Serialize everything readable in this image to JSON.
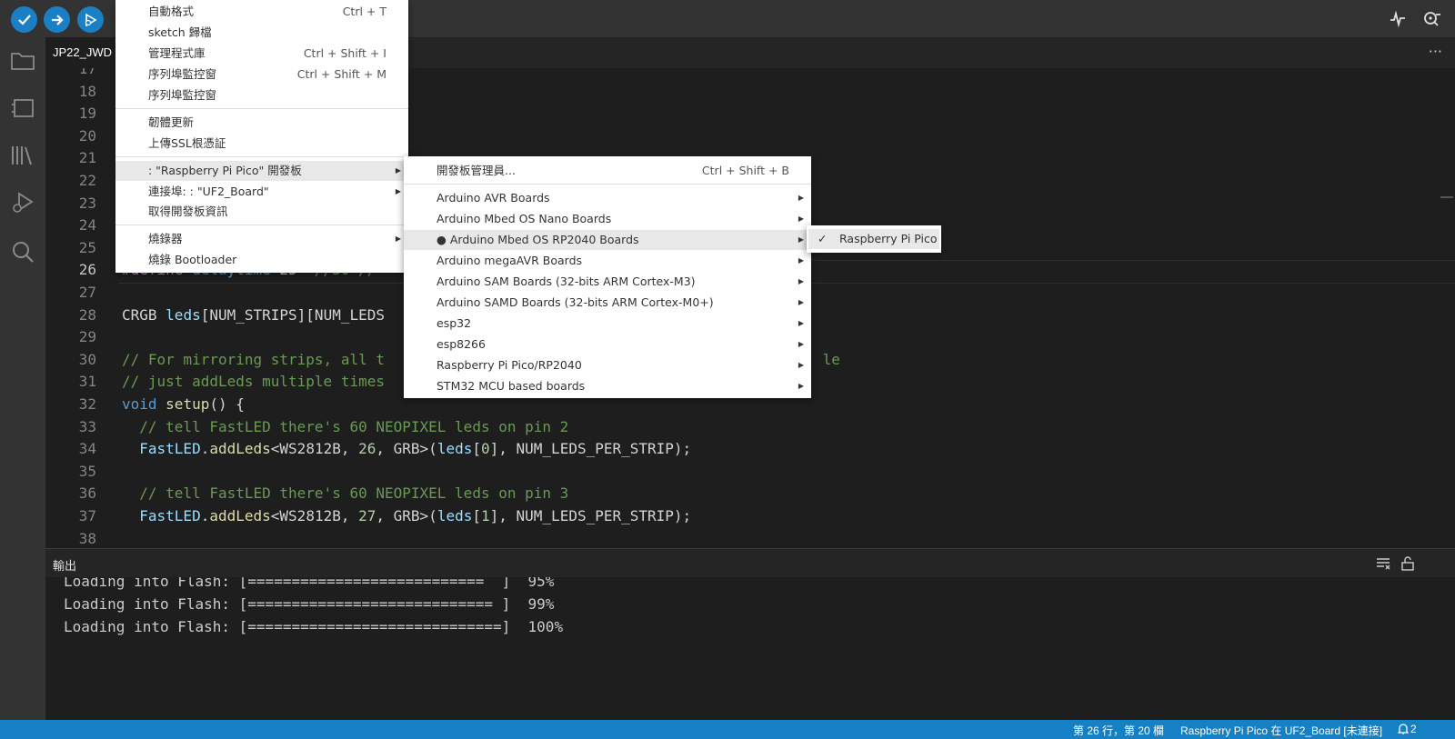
{
  "tab": {
    "label": "JP22_JWD"
  },
  "editor": {
    "lines": [
      {
        "n": "17",
        "parts": []
      },
      {
        "n": "18",
        "parts": []
      },
      {
        "n": "19",
        "parts": []
      },
      {
        "n": "20",
        "parts": []
      },
      {
        "n": "21",
        "parts": []
      },
      {
        "n": "22",
        "parts": []
      },
      {
        "n": "23",
        "parts": []
      },
      {
        "n": "24",
        "parts": []
      },
      {
        "n": "25",
        "parts": []
      },
      {
        "n": "26",
        "parts": [
          {
            "t": "#define ",
            "c": "pre"
          },
          {
            "t": "delaytime ",
            "c": "kw"
          },
          {
            "t": "25",
            "c": "num"
          },
          {
            "t": "  //30 //",
            "c": "com"
          }
        ]
      },
      {
        "n": "27",
        "parts": []
      },
      {
        "n": "28",
        "parts": [
          {
            "t": "CRGB ",
            "c": ""
          },
          {
            "t": "leds",
            "c": "var"
          },
          {
            "t": "[NUM_STRIPS][NUM_LEDS",
            "c": ""
          }
        ]
      },
      {
        "n": "29",
        "parts": []
      },
      {
        "n": "30",
        "parts": [
          {
            "t": "// For mirroring strips, all t",
            "c": "com"
          },
          {
            "t": "                                                  ",
            "c": ""
          },
          {
            "t": "le",
            "c": "com"
          }
        ]
      },
      {
        "n": "31",
        "parts": [
          {
            "t": "// just addLeds multiple times",
            "c": "com"
          }
        ]
      },
      {
        "n": "32",
        "parts": [
          {
            "t": "void ",
            "c": "kw"
          },
          {
            "t": "setup",
            "c": "fn"
          },
          {
            "t": "() {",
            "c": ""
          }
        ]
      },
      {
        "n": "33",
        "parts": [
          {
            "t": "  // tell FastLED there's 60 NEOPIXEL leds on pin 2",
            "c": "com"
          }
        ]
      },
      {
        "n": "34",
        "parts": [
          {
            "t": "  ",
            "c": ""
          },
          {
            "t": "FastLED",
            "c": "var"
          },
          {
            "t": ".",
            "c": ""
          },
          {
            "t": "addLeds",
            "c": "fn"
          },
          {
            "t": "<WS2812B, ",
            "c": ""
          },
          {
            "t": "26",
            "c": "num"
          },
          {
            "t": ", GRB>(",
            "c": ""
          },
          {
            "t": "leds",
            "c": "var"
          },
          {
            "t": "[",
            "c": ""
          },
          {
            "t": "0",
            "c": "num"
          },
          {
            "t": "], NUM_LEDS_PER_STRIP);",
            "c": ""
          }
        ]
      },
      {
        "n": "35",
        "parts": []
      },
      {
        "n": "36",
        "parts": [
          {
            "t": "  // tell FastLED there's 60 NEOPIXEL leds on pin 3",
            "c": "com"
          }
        ]
      },
      {
        "n": "37",
        "parts": [
          {
            "t": "  ",
            "c": ""
          },
          {
            "t": "FastLED",
            "c": "var"
          },
          {
            "t": ".",
            "c": ""
          },
          {
            "t": "addLeds",
            "c": "fn"
          },
          {
            "t": "<WS2812B, ",
            "c": ""
          },
          {
            "t": "27",
            "c": "num"
          },
          {
            "t": ", GRB>(",
            "c": ""
          },
          {
            "t": "leds",
            "c": "var"
          },
          {
            "t": "[",
            "c": ""
          },
          {
            "t": "1",
            "c": "num"
          },
          {
            "t": "], NUM_LEDS_PER_STRIP);",
            "c": ""
          }
        ]
      },
      {
        "n": "38",
        "parts": []
      }
    ]
  },
  "output": {
    "title": "輸出",
    "lines": [
      "Loading into Flash: [===========================  ]  95%",
      "Loading into Flash: [============================ ]  99%",
      "Loading into Flash: [=============================]  100%"
    ]
  },
  "status": {
    "position": "第 26 行，第 20 欄",
    "board": "Raspberry Pi Pico 在 UF2_Board [未連接]",
    "notifications": "2"
  },
  "tools_menu": {
    "items": [
      {
        "label": "自動格式",
        "shortcut": "Ctrl + T"
      },
      {
        "label": "sketch 歸檔",
        "shortcut": ""
      },
      {
        "label": "管理程式庫",
        "shortcut": "Ctrl + Shift + I"
      },
      {
        "label": "序列埠監控窗",
        "shortcut": "Ctrl + Shift + M"
      },
      {
        "label": "序列埠監控窗",
        "shortcut": ""
      },
      {
        "label": "韌體更新",
        "shortcut": ""
      },
      {
        "label": "上傳SSL根憑証",
        "shortcut": ""
      },
      {
        "label": ": \"Raspberry Pi Pico\" 開發板",
        "shortcut": ""
      },
      {
        "label": "連接埠: : \"UF2_Board\"",
        "shortcut": ""
      },
      {
        "label": "取得開發板資訊",
        "shortcut": ""
      },
      {
        "label": "燒錄器",
        "shortcut": ""
      },
      {
        "label": "燒錄 Bootloader",
        "shortcut": ""
      }
    ]
  },
  "board_menu": {
    "manager": {
      "label": "開發板管理員...",
      "shortcut": "Ctrl + Shift + B"
    },
    "items": [
      "Arduino AVR Boards",
      "Arduino Mbed OS Nano Boards",
      "● Arduino Mbed OS RP2040 Boards",
      "Arduino megaAVR Boards",
      "Arduino SAM Boards (32-bits ARM Cortex-M3)",
      "Arduino SAMD Boards (32-bits ARM Cortex-M0+)",
      "esp32",
      "esp8266",
      "Raspberry Pi Pico/RP2040",
      "STM32 MCU based boards"
    ]
  },
  "rp2040_menu": {
    "check": "✓",
    "item": "Raspberry Pi Pico"
  },
  "colors": {
    "accent": "#1a7fc4",
    "statusbar": "#1580c4",
    "comment": "#6a9955",
    "keyword": "#569cd6",
    "function": "#dcdcaa"
  }
}
